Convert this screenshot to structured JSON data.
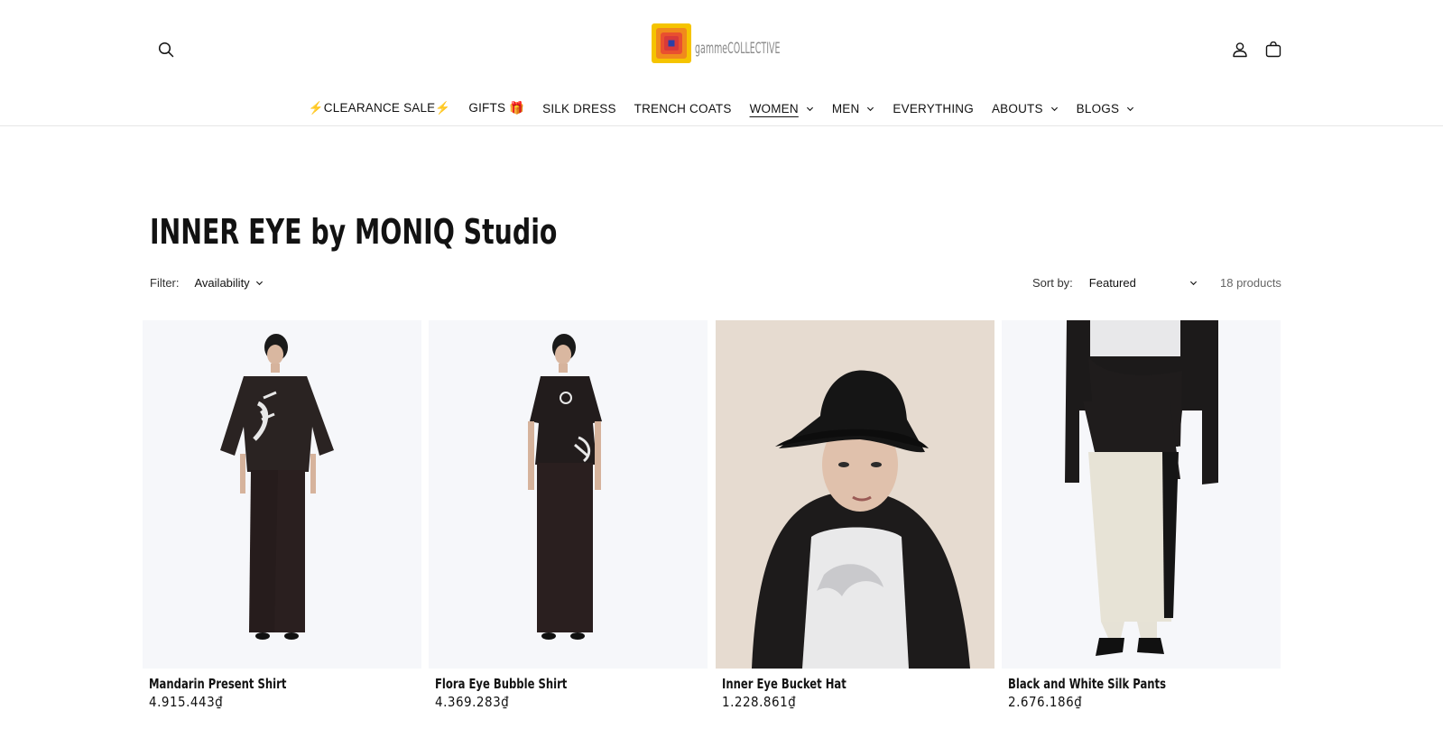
{
  "brand": {
    "logo_text": "gammeCOLLECTIVE",
    "logo_colors": [
      "#f5c400",
      "#f08a1c",
      "#e9502f",
      "#d03a3a",
      "#2b3fa8"
    ]
  },
  "header": {
    "search_icon": "search-icon",
    "account_icon": "user-icon",
    "cart_icon": "cart-icon"
  },
  "nav": {
    "items": [
      {
        "label": "⚡CLEARANCE SALE⚡",
        "dropdown": false,
        "active": false
      },
      {
        "label": "GIFTS 🎁",
        "dropdown": false,
        "active": false
      },
      {
        "label": "SILK DRESS",
        "dropdown": false,
        "active": false
      },
      {
        "label": "TRENCH COATS",
        "dropdown": false,
        "active": false
      },
      {
        "label": "WOMEN",
        "dropdown": true,
        "active": true
      },
      {
        "label": "MEN",
        "dropdown": true,
        "active": false
      },
      {
        "label": "EVERYTHING",
        "dropdown": false,
        "active": false
      },
      {
        "label": "ABOUTS",
        "dropdown": true,
        "active": false
      },
      {
        "label": "BLOGS",
        "dropdown": true,
        "active": false
      }
    ]
  },
  "collection": {
    "title": "INNER EYE by MONIQ Studio",
    "filter_label": "Filter:",
    "filter_availability": "Availability",
    "sort_label": "Sort by:",
    "sort_value": "Featured",
    "product_count": "18 products"
  },
  "products": [
    {
      "name": "Mandarin Present Shirt",
      "price": "4.915.443₫",
      "bg": "#f6f7fa"
    },
    {
      "name": "Flora Eye Bubble Shirt",
      "price": "4.369.283₫",
      "bg": "#f6f7fa"
    },
    {
      "name": "Inner Eye Bucket Hat",
      "price": "1.228.861₫",
      "bg": "#e6dbd0"
    },
    {
      "name": "Black and White Silk Pants",
      "price": "2.676.186₫",
      "bg": "#f6f7fa"
    }
  ]
}
